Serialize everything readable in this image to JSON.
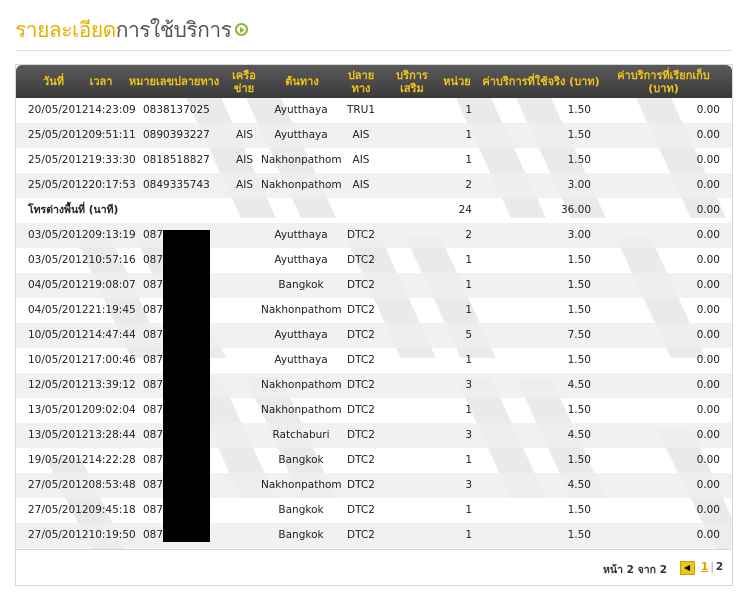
{
  "title": {
    "part1": "รายละเอียด",
    "part2": "การใช้บริการ",
    "icon": "circle-arrow-icon"
  },
  "table": {
    "headers": [
      "วันที่",
      "เวลา",
      "หมายเลขปลายทาง",
      "เครือข่าย",
      "ต้นทาง",
      "ปลายทาง",
      "บริการเสริม",
      "หน่วย",
      "ค่าบริการที่ใช้จริง (บาท)",
      "ค่าบริการที่เรียกเก็บ (บาท)"
    ],
    "rows": [
      {
        "type": "data",
        "datetime": "20/05/201214:23:09",
        "number": "0838137025",
        "network": "",
        "origin": "Ayutthaya",
        "dest": "TRU1",
        "extra": "",
        "units": "1",
        "actual": "1.50",
        "charged": "0.00"
      },
      {
        "type": "data",
        "datetime": "25/05/201209:51:11",
        "number": "0890393227",
        "network": "AIS",
        "origin": "Ayutthaya",
        "dest": "AIS",
        "extra": "",
        "units": "1",
        "actual": "1.50",
        "charged": "0.00"
      },
      {
        "type": "data",
        "datetime": "25/05/201219:33:30",
        "number": "0818518827",
        "network": "AIS",
        "origin": "Nakhonpathom",
        "dest": "AIS",
        "extra": "",
        "units": "1",
        "actual": "1.50",
        "charged": "0.00"
      },
      {
        "type": "data",
        "datetime": "25/05/201220:17:53",
        "number": "0849335743",
        "network": "AIS",
        "origin": "Nakhonpathom",
        "dest": "AIS",
        "extra": "",
        "units": "2",
        "actual": "3.00",
        "charged": "0.00"
      },
      {
        "type": "summary",
        "label": "โทรต่างพื้นที่ (นาที)",
        "units": "24",
        "actual": "36.00",
        "charged": "0.00"
      },
      {
        "type": "data",
        "datetime": "03/05/201209:13:19",
        "number": "087",
        "network": "",
        "origin": "Ayutthaya",
        "dest": "DTC2",
        "extra": "",
        "units": "2",
        "actual": "3.00",
        "charged": "0.00"
      },
      {
        "type": "data",
        "datetime": "03/05/201210:57:16",
        "number": "087",
        "network": "",
        "origin": "Ayutthaya",
        "dest": "DTC2",
        "extra": "",
        "units": "1",
        "actual": "1.50",
        "charged": "0.00"
      },
      {
        "type": "data",
        "datetime": "04/05/201219:08:07",
        "number": "087",
        "network": "",
        "origin": "Bangkok",
        "dest": "DTC2",
        "extra": "",
        "units": "1",
        "actual": "1.50",
        "charged": "0.00"
      },
      {
        "type": "data",
        "datetime": "04/05/201221:19:45",
        "number": "087",
        "network": "",
        "origin": "Nakhonpathom",
        "dest": "DTC2",
        "extra": "",
        "units": "1",
        "actual": "1.50",
        "charged": "0.00"
      },
      {
        "type": "data",
        "datetime": "10/05/201214:47:44",
        "number": "087",
        "network": "",
        "origin": "Ayutthaya",
        "dest": "DTC2",
        "extra": "",
        "units": "5",
        "actual": "7.50",
        "charged": "0.00"
      },
      {
        "type": "data",
        "datetime": "10/05/201217:00:46",
        "number": "087",
        "network": "",
        "origin": "Ayutthaya",
        "dest": "DTC2",
        "extra": "",
        "units": "1",
        "actual": "1.50",
        "charged": "0.00"
      },
      {
        "type": "data",
        "datetime": "12/05/201213:39:12",
        "number": "087",
        "network": "",
        "origin": "Nakhonpathom",
        "dest": "DTC2",
        "extra": "",
        "units": "3",
        "actual": "4.50",
        "charged": "0.00"
      },
      {
        "type": "data",
        "datetime": "13/05/201209:02:04",
        "number": "087",
        "network": "",
        "origin": "Nakhonpathom",
        "dest": "DTC2",
        "extra": "",
        "units": "1",
        "actual": "1.50",
        "charged": "0.00"
      },
      {
        "type": "data",
        "datetime": "13/05/201213:28:44",
        "number": "087",
        "network": "",
        "origin": "Ratchaburi",
        "dest": "DTC2",
        "extra": "",
        "units": "3",
        "actual": "4.50",
        "charged": "0.00"
      },
      {
        "type": "data",
        "datetime": "19/05/201214:22:28",
        "number": "087",
        "network": "",
        "origin": "Bangkok",
        "dest": "DTC2",
        "extra": "",
        "units": "1",
        "actual": "1.50",
        "charged": "0.00"
      },
      {
        "type": "data",
        "datetime": "27/05/201208:53:48",
        "number": "087",
        "network": "",
        "origin": "Nakhonpathom",
        "dest": "DTC2",
        "extra": "",
        "units": "3",
        "actual": "4.50",
        "charged": "0.00"
      },
      {
        "type": "data",
        "datetime": "27/05/201209:45:18",
        "number": "087",
        "network": "",
        "origin": "Bangkok",
        "dest": "DTC2",
        "extra": "",
        "units": "1",
        "actual": "1.50",
        "charged": "0.00"
      },
      {
        "type": "data",
        "datetime": "27/05/201210:19:50",
        "number": "087",
        "network": "",
        "origin": "Bangkok",
        "dest": "DTC2",
        "extra": "",
        "units": "1",
        "actual": "1.50",
        "charged": "0.00"
      }
    ]
  },
  "pagination": {
    "info": "หน้า 2 จาก 2",
    "pages": [
      "1",
      "2"
    ],
    "current": "1",
    "prev_icon": "arrow-left-icon"
  },
  "colors": {
    "header_bg": "#444444",
    "header_text": "#f0c419",
    "title_accent": "#e5b100",
    "title_dark": "#555555"
  }
}
